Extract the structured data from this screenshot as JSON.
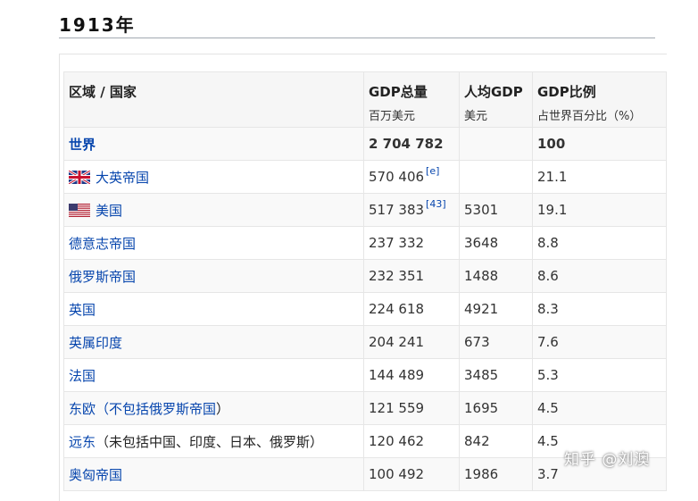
{
  "heading": "1913年",
  "table": {
    "headers": [
      {
        "label": "区域 / 国家",
        "sub": ""
      },
      {
        "label": "GDP总量",
        "sub": "百万美元"
      },
      {
        "label": "人均GDP",
        "sub": "美元"
      },
      {
        "label": "GDP比例",
        "sub": "占世界百分比（%）"
      }
    ],
    "rows": [
      {
        "region": "世界",
        "total": "2 704 782",
        "ref": "",
        "per_capita": "",
        "share": "100"
      },
      {
        "region": "大英帝国",
        "total": "570 406",
        "ref": "[e]",
        "per_capita": "",
        "share": "21.1"
      },
      {
        "region": "美国",
        "total": "517 383",
        "ref": "[43]",
        "per_capita": "5301",
        "share": "19.1"
      },
      {
        "region": "德意志帝国",
        "total": "237 332",
        "ref": "",
        "per_capita": "3648",
        "share": "8.8"
      },
      {
        "region": "俄罗斯帝国",
        "total": "232 351",
        "ref": "",
        "per_capita": "1488",
        "share": "8.6"
      },
      {
        "region": "英国",
        "total": "224 618",
        "ref": "",
        "per_capita": "4921",
        "share": "8.3"
      },
      {
        "region": "英属印度",
        "total": "204 241",
        "ref": "",
        "per_capita": "673",
        "share": "7.6"
      },
      {
        "region": "法国",
        "total": "144 489",
        "ref": "",
        "per_capita": "3485",
        "share": "5.3"
      },
      {
        "region_prefix": "东欧（不包括",
        "region_link": "俄罗斯帝国",
        "region_suffix": "）",
        "total": "121 559",
        "ref": "",
        "per_capita": "1695",
        "share": "4.5"
      },
      {
        "region_link": "远东",
        "region_plain": "（未包括中国、印度、日本、俄罗斯）",
        "total": "120 462",
        "ref": "",
        "per_capita": "842",
        "share": "4.5"
      },
      {
        "region": "奥匈帝国",
        "total": "100 492",
        "ref": "",
        "per_capita": "1986",
        "share": "3.7"
      }
    ]
  },
  "watermark": "知乎 @刘澳",
  "colors": {
    "link": "#0645ad",
    "header_bg": "#f6f6f6",
    "border": "#e6e6e6"
  }
}
